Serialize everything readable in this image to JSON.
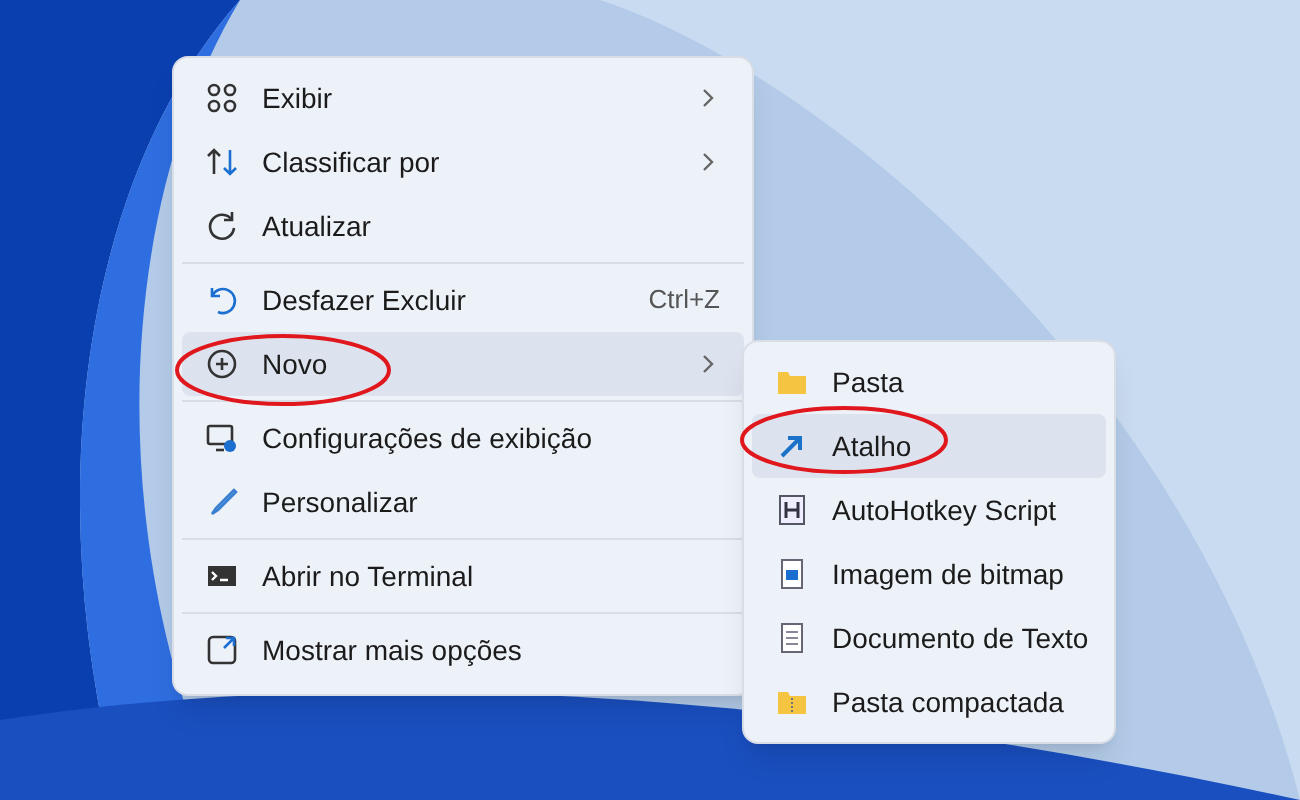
{
  "menu": {
    "groups": [
      {
        "items": [
          {
            "label": "Exibir",
            "submenu": true,
            "selected": false
          },
          {
            "label": "Classificar por",
            "submenu": true,
            "selected": false
          },
          {
            "label": "Atualizar",
            "submenu": false,
            "selected": false
          }
        ]
      },
      {
        "items": [
          {
            "label": "Desfazer Excluir",
            "shortcut": "Ctrl+Z",
            "submenu": false,
            "selected": false
          },
          {
            "label": "Novo",
            "submenu": true,
            "selected": true
          }
        ]
      },
      {
        "items": [
          {
            "label": "Configurações de exibição",
            "submenu": false,
            "selected": false
          },
          {
            "label": "Personalizar",
            "submenu": false,
            "selected": false
          }
        ]
      },
      {
        "items": [
          {
            "label": "Abrir no Terminal",
            "submenu": false,
            "selected": false
          }
        ]
      },
      {
        "items": [
          {
            "label": "Mostrar mais opções",
            "submenu": false,
            "selected": false
          }
        ]
      }
    ]
  },
  "submenu": {
    "items": [
      {
        "label": "Pasta",
        "selected": false
      },
      {
        "label": "Atalho",
        "selected": true
      },
      {
        "label": "AutoHotkey Script",
        "selected": false
      },
      {
        "label": "Imagem de bitmap",
        "selected": false
      },
      {
        "label": "Documento de Texto",
        "selected": false
      },
      {
        "label": "Pasta compactada",
        "selected": false
      }
    ]
  }
}
